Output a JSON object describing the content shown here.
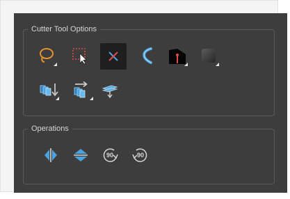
{
  "panel": {
    "cutter_options_title": "Cutter Tool Options",
    "operations_title": "Operations"
  },
  "tools": [
    {
      "name": "lasso",
      "icon": "lasso-icon",
      "selected": false
    },
    {
      "name": "marquee",
      "icon": "marquee-select-icon",
      "selected": false
    },
    {
      "name": "cutter-mode",
      "icon": "cutter-cross-icon",
      "selected": true
    },
    {
      "name": "smooth",
      "icon": "smooth-curve-icon",
      "selected": false
    },
    {
      "name": "tip",
      "icon": "pencil-tip-icon",
      "selected": false
    },
    {
      "name": "shading",
      "icon": "shade-square-icon",
      "selected": false
    },
    {
      "name": "stack-down",
      "icon": "stack-down-icon",
      "selected": false
    },
    {
      "name": "stack-right",
      "icon": "stack-right-icon",
      "selected": false
    },
    {
      "name": "flatten",
      "icon": "flatten-icon",
      "selected": false
    }
  ],
  "operations": [
    {
      "name": "flip-horizontal",
      "icon": "flip-horizontal-icon"
    },
    {
      "name": "flip-vertical",
      "icon": "flip-vertical-icon"
    },
    {
      "name": "rotate-cw",
      "icon": "rotate-90-cw-icon",
      "label": "90"
    },
    {
      "name": "rotate-ccw",
      "icon": "rotate-90-ccw-icon",
      "label": "90"
    }
  ],
  "colors": {
    "panel_bg": "#3d3d3d",
    "accent_orange": "#e3922f",
    "accent_blue": "#4aa3e0",
    "icon_red": "#e04a4a"
  }
}
